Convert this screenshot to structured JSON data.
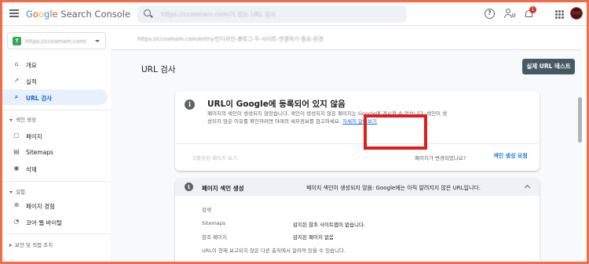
{
  "app": {
    "logo_google": [
      "G",
      "o",
      "o",
      "g",
      "l",
      "e"
    ],
    "logo_suffix": "Search Console",
    "search_placeholder": "https://ccosmam.com/가 있는 URL 검사",
    "help_glyph": "?",
    "notification_count": "1",
    "avatar_text": "결정권"
  },
  "property": {
    "badge": "T",
    "name": "https://ccosmam.com/"
  },
  "sidebar": {
    "items": [
      {
        "icon": "⌂",
        "label": "개요"
      },
      {
        "icon": "↗",
        "label": "실적"
      },
      {
        "icon": "⌕",
        "label": "URL 검사"
      }
    ],
    "section_index": "색인 생성",
    "index_items": [
      {
        "icon": "▢",
        "label": "페이지"
      },
      {
        "icon": "▤",
        "label": "Sitemaps"
      },
      {
        "icon": "◉",
        "label": "삭제"
      }
    ],
    "section_experience": "실험",
    "experience_items": [
      {
        "icon": "⊕",
        "label": "페이지 경험"
      },
      {
        "icon": "◔",
        "label": "코어 웹 바이탈"
      }
    ],
    "section_security": "보안 및 직접 조치"
  },
  "main": {
    "url_breadcrumb": "https://ccosmam.com/entry/인디자인-블로그-두-사이트-연결하기-필요-환경",
    "page_title": "URL 검사",
    "live_test_label": "실제 URL 테스트",
    "status_card": {
      "info_glyph": "i",
      "heading": "URL이 Google에 등록되어 있지 않음",
      "description": "페이지의 색인이 생성되지 않았습니다. 색인이 생성되지 않은 페이지는 Google에 게시할 수 없습니다. 색인이 생성되지 않은 이유를 확인하려면 아래의 세부정보를 참고하세요.",
      "learn_more": "자세히 알아보기",
      "crawled_link": "크롤링된 페이지 보기",
      "changed_text": "페이지가 변경되었나요?",
      "request_index_label": "색인 생성 요청"
    },
    "index_card": {
      "info_glyph": "i",
      "title": "페이지 색인 생성",
      "summary": "페이지 색인이 생성되지 않음: Google에는 아직 알려지지 않은 URL입니다.",
      "section_label": "검색",
      "rows": [
        {
          "label": "Sitemaps",
          "value": "감지된 참조 사이트맵이 없습니다."
        },
        {
          "label": "참조 페이지",
          "value": "감지된 페이지 없음"
        }
      ],
      "footer_note": "URL이 현재 보고되지 않은 다른 출처에서 알려져 있을 수 있습니다."
    }
  }
}
